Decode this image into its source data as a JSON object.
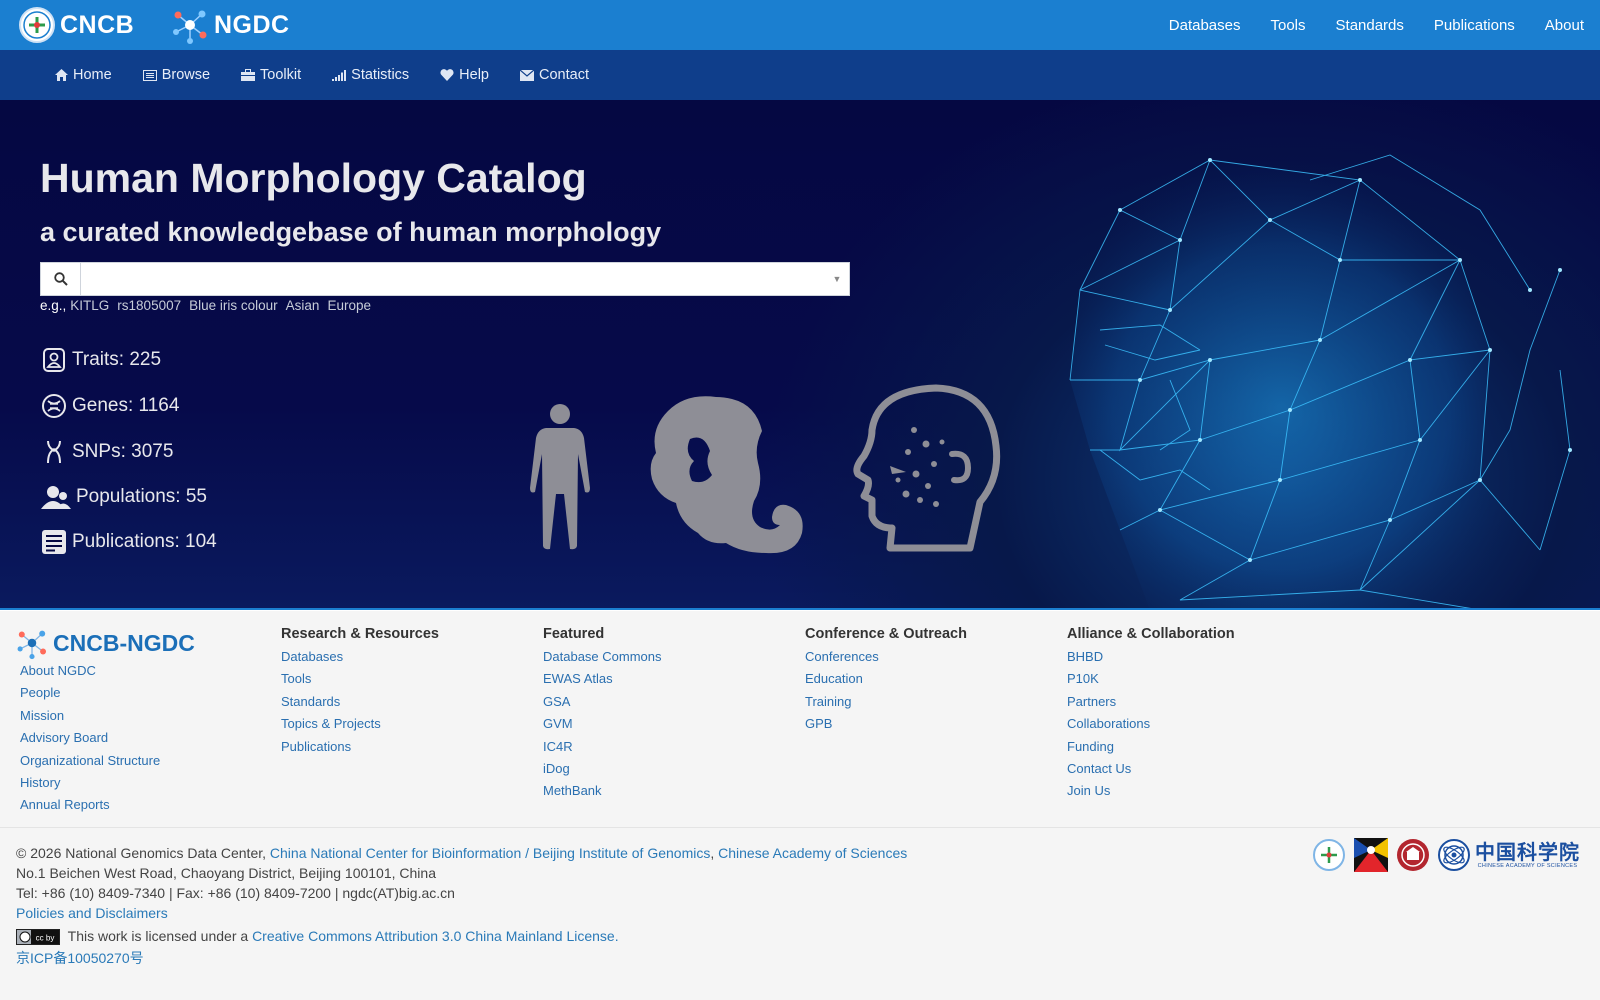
{
  "header": {
    "logo_cncb": "CNCB",
    "logo_ngdc": "NGDC",
    "nav": [
      "Databases",
      "Tools",
      "Standards",
      "Publications",
      "About"
    ]
  },
  "subnav": {
    "items": [
      {
        "label": "Home",
        "icon": "home-icon"
      },
      {
        "label": "Browse",
        "icon": "list-icon"
      },
      {
        "label": "Toolkit",
        "icon": "toolbox-icon"
      },
      {
        "label": "Statistics",
        "icon": "signal-icon"
      },
      {
        "label": "Help",
        "icon": "heart-icon"
      },
      {
        "label": "Contact",
        "icon": "envelope-icon"
      }
    ]
  },
  "hero": {
    "title": "Human Morphology Catalog",
    "subtitle": "a curated knowledgebase of human morphology",
    "search": {
      "value": "",
      "placeholder": ""
    },
    "examples_prefix": "e.g.,",
    "examples": [
      "KITLG",
      "rs1805007",
      "Blue iris colour",
      "Asian",
      "Europe"
    ],
    "stats": [
      {
        "label": "Traits: 225",
        "icon": "trait-icon"
      },
      {
        "label": "Genes: 1164",
        "icon": "gene-icon"
      },
      {
        "label": "SNPs: 3075",
        "icon": "snp-icon"
      },
      {
        "label": "Populations: 55",
        "icon": "population-icon"
      },
      {
        "label": "Publications: 104",
        "icon": "publication-icon"
      }
    ]
  },
  "footer": {
    "logo_text": "CNCB-NGDC",
    "about_links": [
      "About NGDC",
      "People",
      "Mission",
      "Advisory Board",
      "Organizational Structure",
      "History",
      "Annual Reports"
    ],
    "columns": [
      {
        "title": "Research & Resources",
        "links": [
          "Databases",
          "Tools",
          "Standards",
          "Topics & Projects",
          "Publications"
        ]
      },
      {
        "title": "Featured",
        "links": [
          "Database Commons",
          "EWAS Atlas",
          "GSA",
          "GVM",
          "IC4R",
          "iDog",
          "MethBank"
        ]
      },
      {
        "title": "Conference & Outreach",
        "links": [
          "Conferences",
          "Education",
          "Training",
          "GPB"
        ]
      },
      {
        "title": "Alliance & Collaboration",
        "links": [
          "BHBD",
          "P10K",
          "Partners",
          "Collaborations",
          "Funding",
          "Contact Us",
          "Join Us"
        ]
      }
    ],
    "copyright_prefix": "© 2026 National Genomics Data Center,",
    "copyright_link1": "China National Center for Bioinformation / Beijing Institute of Genomics",
    "copyright_sep": ",",
    "copyright_link2": "Chinese Academy of Sciences",
    "address": "No.1 Beichen West Road, Chaoyang District, Beijing 100101, China",
    "contact": "Tel: +86 (10) 8409-7340 | Fax: +86 (10) 8409-7200 | ngdc(AT)big.ac.cn",
    "policies": "Policies and Disclaimers",
    "license_prefix": "This work is licensed under a",
    "license_link": "Creative Commons Attribution 3.0 China Mainland License.",
    "icp": "京ICP备10050270号",
    "cas_logo_text": "中国科学院",
    "cas_logo_sub": "CHINESE ACADEMY OF SCIENCES"
  },
  "colors": {
    "topbar": "#1b7fd0",
    "subbar": "#0f3e8b",
    "hero_bg": "#050842",
    "link": "#2a6fb0"
  }
}
